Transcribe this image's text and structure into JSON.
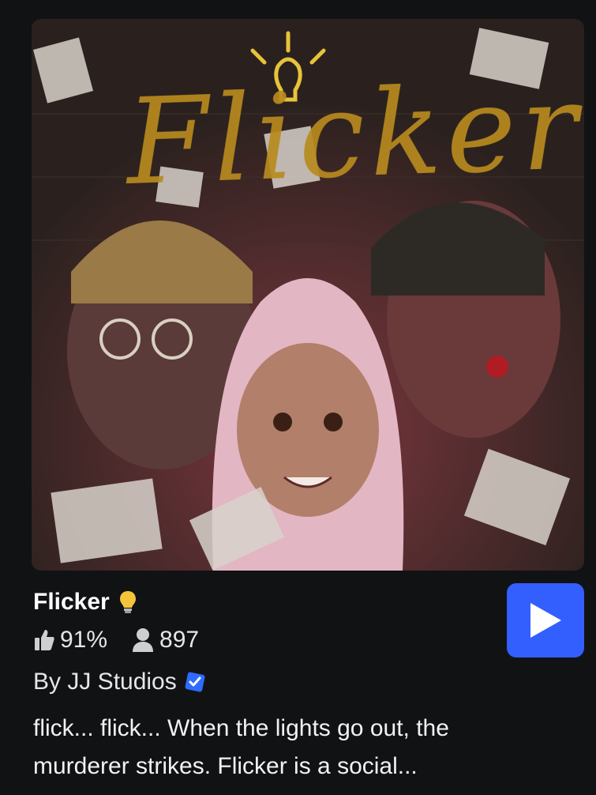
{
  "game": {
    "title": "Flicker",
    "title_icon": "lightbulb-icon",
    "artwork_title": "Flicker",
    "rating": "91%",
    "players": "897",
    "creator": "By JJ Studios",
    "description_line1": "flick... flick... When the lights go out, the",
    "description_line2": "murderer strikes. Flicker is a social...",
    "play_icon": "play-icon"
  },
  "colors": {
    "background": "#111214",
    "play_button": "#335fff",
    "verified": "#2f6bff",
    "bulb": "#f5c43a"
  }
}
